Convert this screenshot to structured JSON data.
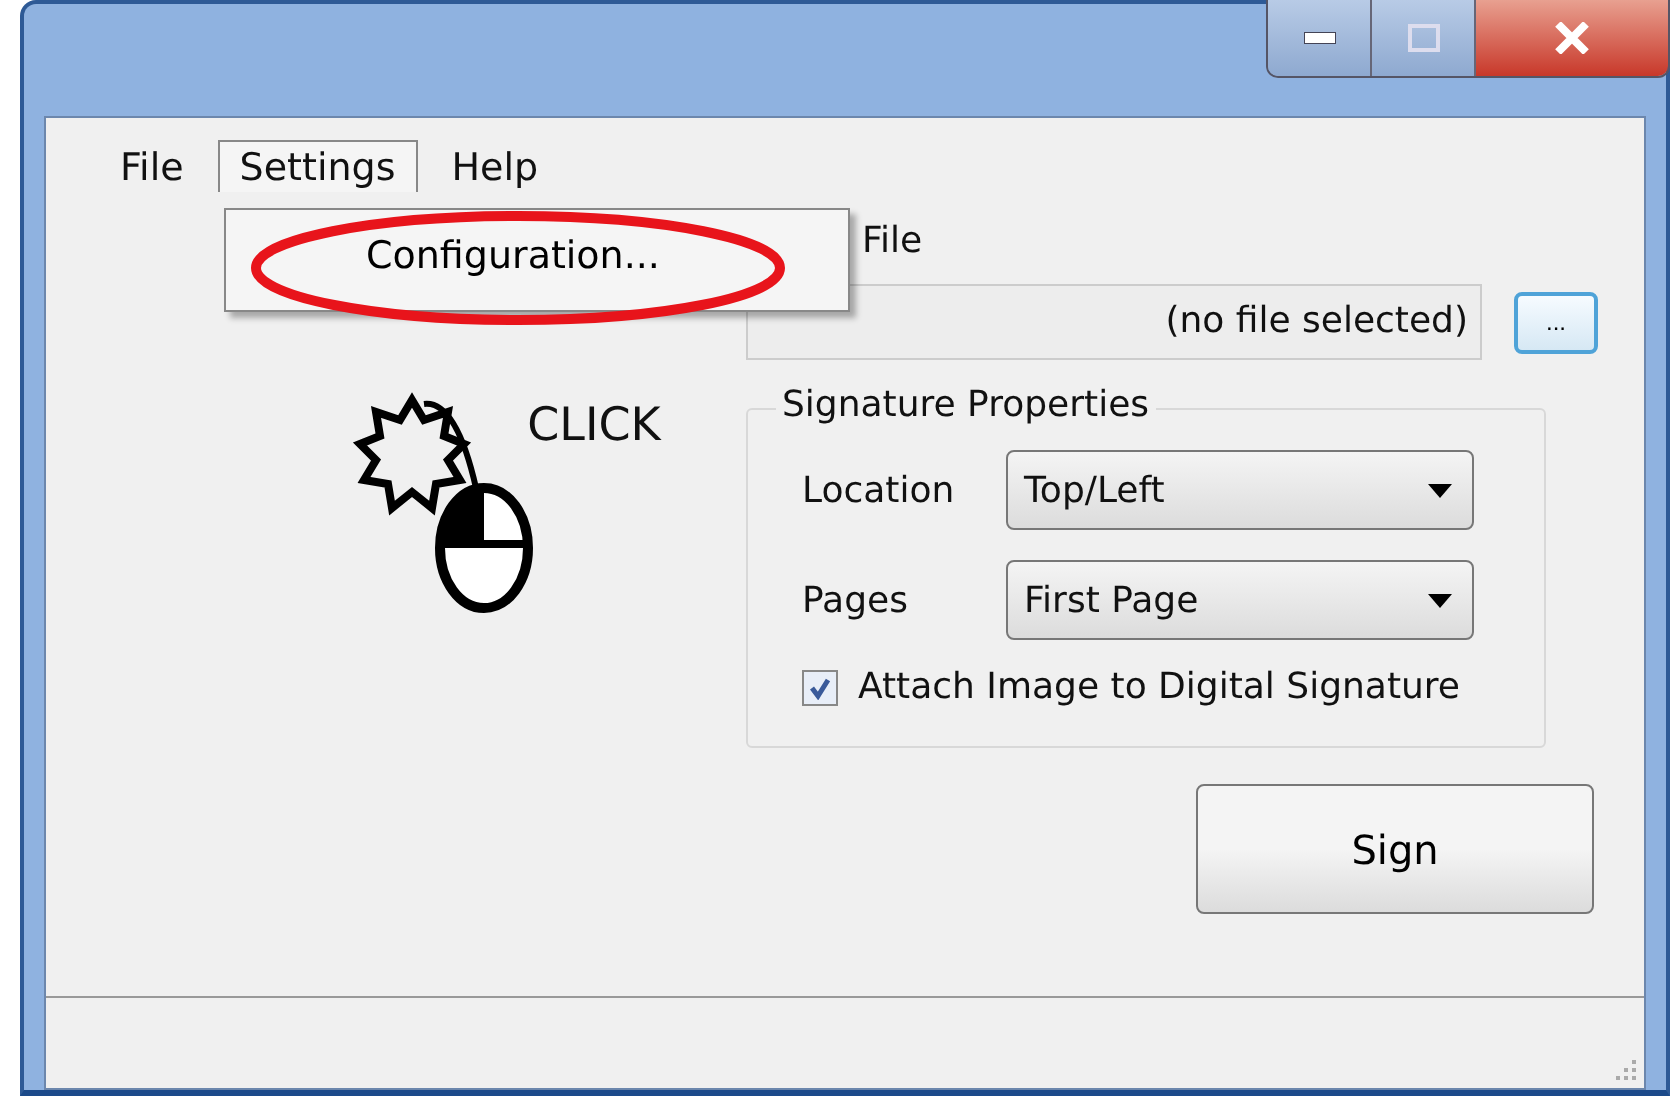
{
  "menu": [
    {
      "label": "File",
      "selected": false
    },
    {
      "label": "Settings",
      "selected": true
    },
    {
      "label": "Help",
      "selected": false
    }
  ],
  "dropdown": {
    "items": [
      {
        "label": "Configuration...",
        "highlighted": true
      }
    ]
  },
  "file": {
    "label": "File",
    "value": "(no file selected)",
    "browse_button": "..."
  },
  "picture": {
    "caption": "CLICK"
  },
  "signature_properties": {
    "title": "Signature Properties",
    "fields": [
      {
        "label": "Location",
        "value": "Top/Left"
      },
      {
        "label": "Pages",
        "value": "First Page"
      }
    ],
    "checkbox": {
      "label": "Attach Image to Digital Signature",
      "checked": true
    }
  },
  "sign_button": "Sign"
}
